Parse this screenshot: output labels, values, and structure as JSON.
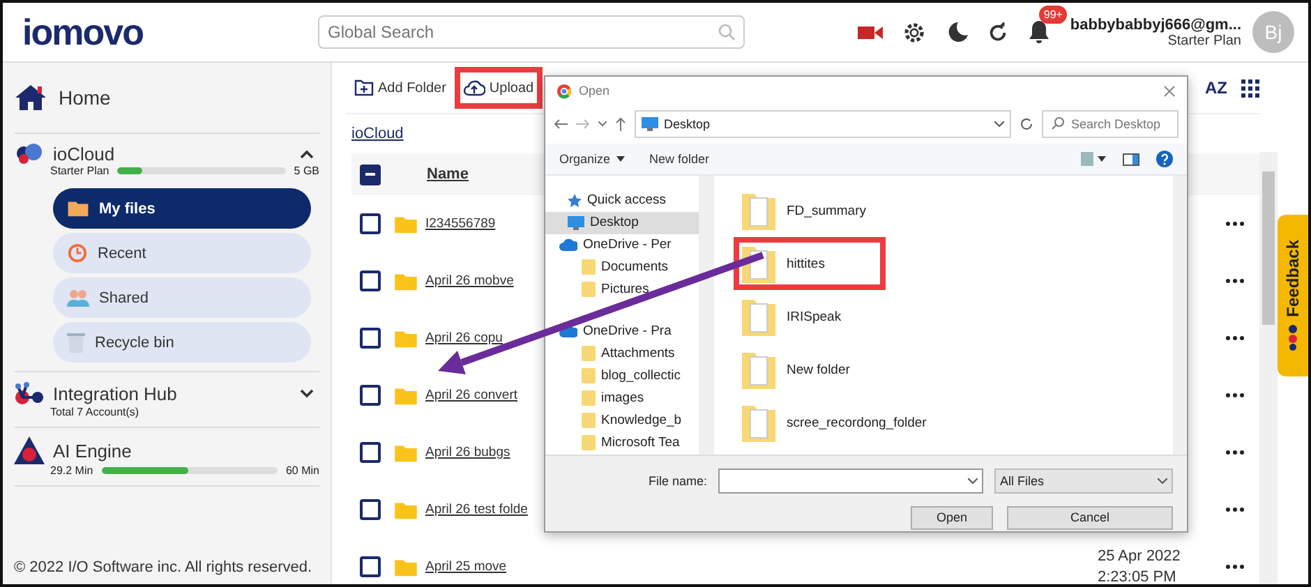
{
  "header": {
    "logo": "iomovo",
    "search": {
      "placeholder": "Global Search"
    },
    "notification_badge": "99+",
    "user": {
      "email": "babbybabbyj666@gm...",
      "plan": "Starter Plan",
      "avatar": "Bj"
    }
  },
  "sidebar": {
    "home": {
      "label": "Home"
    },
    "sections": [
      {
        "kind": "storage",
        "title": "ioCloud",
        "subtitle": "Starter Plan",
        "level": 0.15,
        "reading": "5 GB",
        "expanded": true,
        "items": [
          {
            "kind": "files",
            "label": "My files",
            "selected": true
          },
          {
            "kind": "recent",
            "label": "Recent",
            "selected": false
          },
          {
            "kind": "shared",
            "label": "Shared",
            "selected": false
          },
          {
            "kind": "trash",
            "label": "Recycle bin",
            "selected": false
          }
        ]
      },
      {
        "kind": "accounts",
        "title": "Integration Hub",
        "subtitle": "Total 7 Account(s)",
        "expanded": false
      },
      {
        "kind": "usage",
        "title": "AI Engine",
        "subtitle": "29.2 Min",
        "level": 0.49,
        "reading": "60 Min"
      }
    ],
    "footer": "© 2022 I/O Software inc. All rights reserved."
  },
  "toolbar": {
    "actions": [
      {
        "kind": "add-folder",
        "label": "Add Folder",
        "highlighted": false
      },
      {
        "kind": "upload",
        "label": "Upload",
        "highlighted": true
      }
    ],
    "sort_label": "AZ"
  },
  "breadcrumb": "ioCloud",
  "table": {
    "header_checkbox_partial": true,
    "columns": [
      {
        "label": "Name"
      }
    ],
    "rows": [
      {
        "name": "I234556789",
        "checked": false
      },
      {
        "name": "April 26 mobve",
        "checked": false
      },
      {
        "name": "April 26 copu",
        "checked": false
      },
      {
        "name": "April 26 convert",
        "checked": false
      },
      {
        "name": "April 26 bubgs",
        "checked": false
      },
      {
        "name": "April 26 test folde",
        "checked": false
      },
      {
        "name": "April 25 move",
        "checked": false,
        "date": "25 Apr 2022",
        "time": "2:23:05 PM"
      }
    ]
  },
  "feedback": {
    "label": "Feedback"
  },
  "dialog": {
    "title": "Open",
    "path": "Desktop",
    "search": {
      "placeholder": "Search Desktop"
    },
    "commands": [
      {
        "label": "Organize",
        "menu": true
      },
      {
        "label": "New folder",
        "menu": false
      }
    ],
    "tree": [
      {
        "kind": "star",
        "label": "Quick access",
        "selected": false
      },
      {
        "kind": "desktop",
        "label": "Desktop",
        "selected": true
      },
      {
        "kind": "cloud",
        "label": "OneDrive - Per",
        "selected": false,
        "children": [
          {
            "kind": "folder",
            "label": "Documents",
            "selected": false
          },
          {
            "kind": "folder",
            "label": "Pictures",
            "selected": false
          }
        ]
      },
      {
        "kind": "cloud",
        "label": "OneDrive - Pra",
        "selected": false,
        "children": [
          {
            "kind": "folder",
            "label": "Attachments",
            "selected": false
          },
          {
            "kind": "folder",
            "label": "blog_collectic",
            "selected": false
          },
          {
            "kind": "folder",
            "label": "images",
            "selected": false
          },
          {
            "kind": "folder",
            "label": "Knowledge_b",
            "selected": false
          },
          {
            "kind": "folder",
            "label": "Microsoft Tea",
            "selected": false
          }
        ]
      }
    ],
    "files": [
      {
        "name": "FD_summary",
        "highlighted": false
      },
      {
        "name": "hittites",
        "highlighted": true
      },
      {
        "name": "IRISpeak",
        "highlighted": false
      },
      {
        "name": "New folder",
        "highlighted": false
      },
      {
        "name": "scree_recordong_folder",
        "highlighted": false
      }
    ],
    "file_name_label": "File name:",
    "file_type": "All Files",
    "buttons": [
      "Open",
      "Cancel"
    ]
  }
}
